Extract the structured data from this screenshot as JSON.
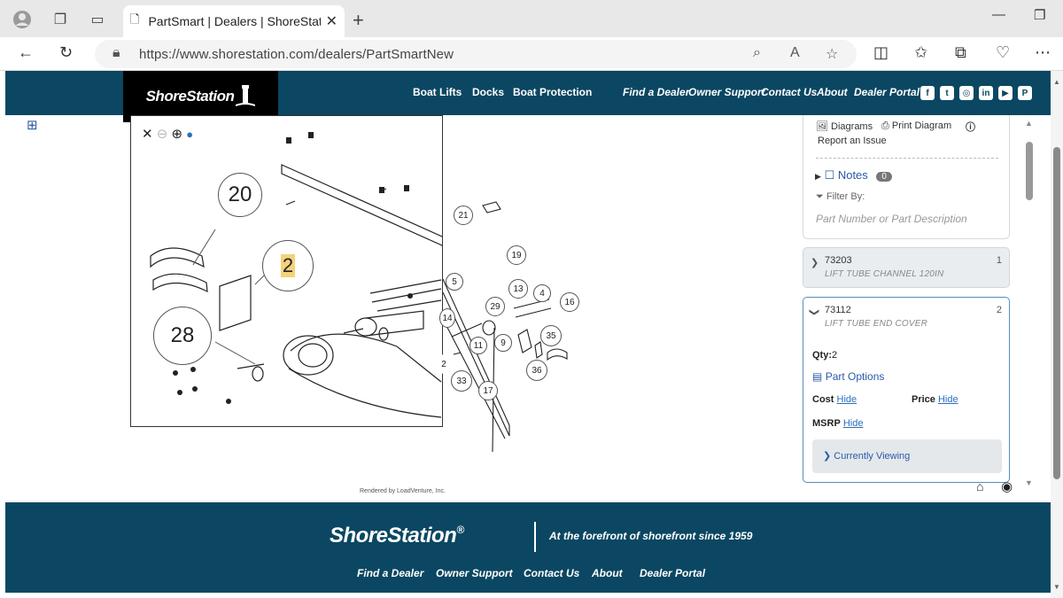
{
  "browser": {
    "tab_title": "PartSmart | Dealers | ShoreStation",
    "url": "https://www.shorestation.com/dealers/PartSmartNew",
    "new_tab_glyph": "+",
    "close_glyph": "✕"
  },
  "header": {
    "logo": "ShoreStation",
    "nav_primary": [
      "Boat Lifts",
      "Docks",
      "Boat Protection"
    ],
    "nav_secondary": [
      "Find a Dealer",
      "Owner Support",
      "Contact Us",
      "About",
      "Dealer Portal"
    ],
    "social_icons": [
      "facebook-icon",
      "twitter-icon",
      "instagram-icon",
      "linkedin-icon",
      "youtube-icon",
      "pinterest-icon"
    ]
  },
  "diagram": {
    "callouts_inside": [
      "20",
      "2",
      "28"
    ],
    "callouts_outside": [
      "21",
      "19",
      "5",
      "13",
      "4",
      "16",
      "29",
      "14",
      "35",
      "11",
      "9",
      "2",
      "36",
      "33",
      "17"
    ],
    "rendered_by": "Rendered by LoadVenture, Inc."
  },
  "panel": {
    "diagrams_label": "Diagrams",
    "print_label": "Print Diagram",
    "report_label": "Report an Issue",
    "notes_label": "Notes",
    "notes_count": "0",
    "filter_label": "Filter By:",
    "filter_placeholder": "Part Number or Part Description",
    "parts": [
      {
        "number": "73203",
        "description": "LIFT TUBE CHANNEL 120IN",
        "ref": "1"
      },
      {
        "number": "73112",
        "description": "LIFT TUBE END COVER",
        "ref": "2"
      }
    ],
    "qty_label": "Qty:",
    "qty_value": "2",
    "part_options_label": "Part Options",
    "cost_label": "Cost",
    "price_label": "Price",
    "msrp_label": "MSRP",
    "hide_label": "Hide",
    "currently_viewing_label": "Currently Viewing"
  },
  "footer": {
    "logo": "ShoreStation",
    "registered": "®",
    "tagline": "At the forefront of shorefront since 1959",
    "links": [
      "Find a Dealer",
      "Owner Support",
      "Contact Us",
      "About",
      "Dealer Portal"
    ]
  }
}
